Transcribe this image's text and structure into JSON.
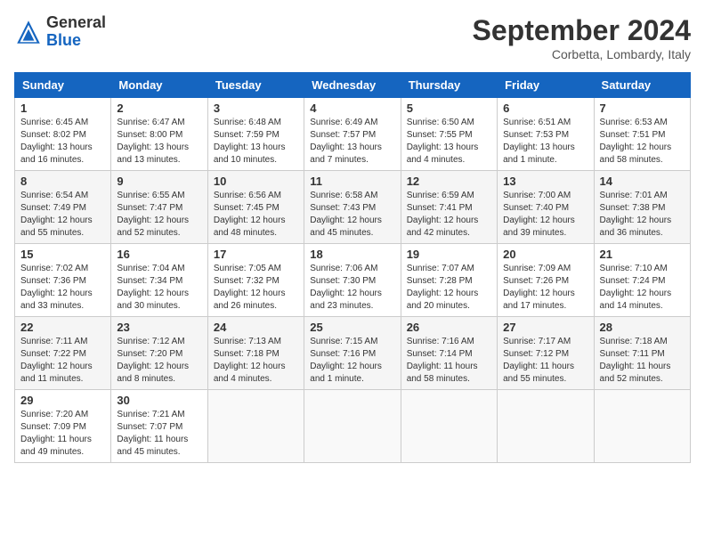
{
  "header": {
    "logo_general": "General",
    "logo_blue": "Blue",
    "month_year": "September 2024",
    "location": "Corbetta, Lombardy, Italy"
  },
  "days_of_week": [
    "Sunday",
    "Monday",
    "Tuesday",
    "Wednesday",
    "Thursday",
    "Friday",
    "Saturday"
  ],
  "weeks": [
    [
      {
        "day": "1",
        "detail": "Sunrise: 6:45 AM\nSunset: 8:02 PM\nDaylight: 13 hours\nand 16 minutes."
      },
      {
        "day": "2",
        "detail": "Sunrise: 6:47 AM\nSunset: 8:00 PM\nDaylight: 13 hours\nand 13 minutes."
      },
      {
        "day": "3",
        "detail": "Sunrise: 6:48 AM\nSunset: 7:59 PM\nDaylight: 13 hours\nand 10 minutes."
      },
      {
        "day": "4",
        "detail": "Sunrise: 6:49 AM\nSunset: 7:57 PM\nDaylight: 13 hours\nand 7 minutes."
      },
      {
        "day": "5",
        "detail": "Sunrise: 6:50 AM\nSunset: 7:55 PM\nDaylight: 13 hours\nand 4 minutes."
      },
      {
        "day": "6",
        "detail": "Sunrise: 6:51 AM\nSunset: 7:53 PM\nDaylight: 13 hours\nand 1 minute."
      },
      {
        "day": "7",
        "detail": "Sunrise: 6:53 AM\nSunset: 7:51 PM\nDaylight: 12 hours\nand 58 minutes."
      }
    ],
    [
      {
        "day": "8",
        "detail": "Sunrise: 6:54 AM\nSunset: 7:49 PM\nDaylight: 12 hours\nand 55 minutes."
      },
      {
        "day": "9",
        "detail": "Sunrise: 6:55 AM\nSunset: 7:47 PM\nDaylight: 12 hours\nand 52 minutes."
      },
      {
        "day": "10",
        "detail": "Sunrise: 6:56 AM\nSunset: 7:45 PM\nDaylight: 12 hours\nand 48 minutes."
      },
      {
        "day": "11",
        "detail": "Sunrise: 6:58 AM\nSunset: 7:43 PM\nDaylight: 12 hours\nand 45 minutes."
      },
      {
        "day": "12",
        "detail": "Sunrise: 6:59 AM\nSunset: 7:41 PM\nDaylight: 12 hours\nand 42 minutes."
      },
      {
        "day": "13",
        "detail": "Sunrise: 7:00 AM\nSunset: 7:40 PM\nDaylight: 12 hours\nand 39 minutes."
      },
      {
        "day": "14",
        "detail": "Sunrise: 7:01 AM\nSunset: 7:38 PM\nDaylight: 12 hours\nand 36 minutes."
      }
    ],
    [
      {
        "day": "15",
        "detail": "Sunrise: 7:02 AM\nSunset: 7:36 PM\nDaylight: 12 hours\nand 33 minutes."
      },
      {
        "day": "16",
        "detail": "Sunrise: 7:04 AM\nSunset: 7:34 PM\nDaylight: 12 hours\nand 30 minutes."
      },
      {
        "day": "17",
        "detail": "Sunrise: 7:05 AM\nSunset: 7:32 PM\nDaylight: 12 hours\nand 26 minutes."
      },
      {
        "day": "18",
        "detail": "Sunrise: 7:06 AM\nSunset: 7:30 PM\nDaylight: 12 hours\nand 23 minutes."
      },
      {
        "day": "19",
        "detail": "Sunrise: 7:07 AM\nSunset: 7:28 PM\nDaylight: 12 hours\nand 20 minutes."
      },
      {
        "day": "20",
        "detail": "Sunrise: 7:09 AM\nSunset: 7:26 PM\nDaylight: 12 hours\nand 17 minutes."
      },
      {
        "day": "21",
        "detail": "Sunrise: 7:10 AM\nSunset: 7:24 PM\nDaylight: 12 hours\nand 14 minutes."
      }
    ],
    [
      {
        "day": "22",
        "detail": "Sunrise: 7:11 AM\nSunset: 7:22 PM\nDaylight: 12 hours\nand 11 minutes."
      },
      {
        "day": "23",
        "detail": "Sunrise: 7:12 AM\nSunset: 7:20 PM\nDaylight: 12 hours\nand 8 minutes."
      },
      {
        "day": "24",
        "detail": "Sunrise: 7:13 AM\nSunset: 7:18 PM\nDaylight: 12 hours\nand 4 minutes."
      },
      {
        "day": "25",
        "detail": "Sunrise: 7:15 AM\nSunset: 7:16 PM\nDaylight: 12 hours\nand 1 minute."
      },
      {
        "day": "26",
        "detail": "Sunrise: 7:16 AM\nSunset: 7:14 PM\nDaylight: 11 hours\nand 58 minutes."
      },
      {
        "day": "27",
        "detail": "Sunrise: 7:17 AM\nSunset: 7:12 PM\nDaylight: 11 hours\nand 55 minutes."
      },
      {
        "day": "28",
        "detail": "Sunrise: 7:18 AM\nSunset: 7:11 PM\nDaylight: 11 hours\nand 52 minutes."
      }
    ],
    [
      {
        "day": "29",
        "detail": "Sunrise: 7:20 AM\nSunset: 7:09 PM\nDaylight: 11 hours\nand 49 minutes."
      },
      {
        "day": "30",
        "detail": "Sunrise: 7:21 AM\nSunset: 7:07 PM\nDaylight: 11 hours\nand 45 minutes."
      },
      {
        "day": "",
        "detail": ""
      },
      {
        "day": "",
        "detail": ""
      },
      {
        "day": "",
        "detail": ""
      },
      {
        "day": "",
        "detail": ""
      },
      {
        "day": "",
        "detail": ""
      }
    ]
  ]
}
